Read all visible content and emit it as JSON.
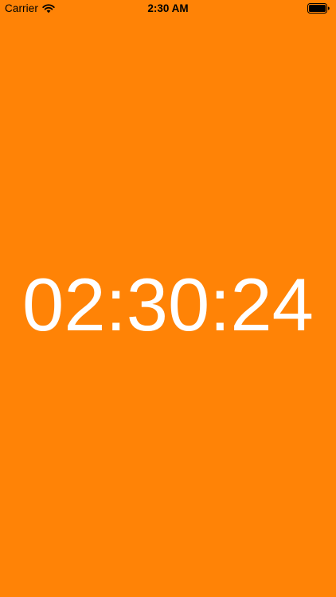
{
  "status_bar": {
    "carrier": "Carrier",
    "time": "2:30 AM",
    "wifi_icon": "wifi-icon",
    "battery_icon": "battery-icon",
    "battery_level": 1.0
  },
  "timer": {
    "display": "02:30:24"
  },
  "colors": {
    "background": "#ff8306",
    "timer_text": "#ffffff",
    "status_text": "#000000"
  }
}
